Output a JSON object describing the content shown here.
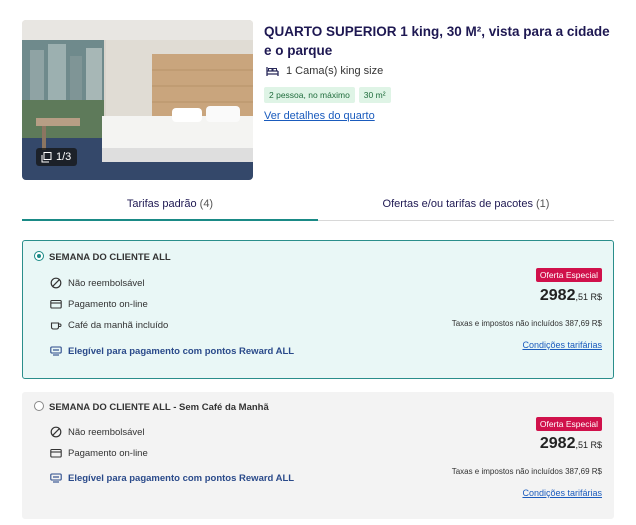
{
  "room": {
    "title": "QUARTO SUPERIOR 1 king, 30 M², vista para a cidade e o parque",
    "bed": "1 Cama(s) king size",
    "tags": [
      "2 pessoa, no máximo",
      "30 m²"
    ],
    "details_link": "Ver detalhes do quarto",
    "photo_counter": "1/3"
  },
  "tabs": [
    {
      "label": "Tarifas padrão",
      "count": "(4)",
      "active": true
    },
    {
      "label": "Ofertas e/ou tarifas de pacotes",
      "count": "(1)",
      "active": false
    }
  ],
  "rates": [
    {
      "name": "SEMANA DO CLIENTE ALL",
      "selected": true,
      "features": [
        "Não reembolsável",
        "Pagamento on-line",
        "Café da manhã incluído"
      ],
      "reward": "Elegível para pagamento com pontos Reward ALL",
      "badge": "Oferta Especial",
      "price_int": "2982",
      "price_dec": ",51 R$",
      "taxes": "Taxas e impostos não incluídos 387,69 R$",
      "conditions": "Condições tarifárias"
    },
    {
      "name": "SEMANA DO CLIENTE ALL - Sem Café da Manhã",
      "selected": false,
      "features": [
        "Não reembolsável",
        "Pagamento on-line"
      ],
      "reward": "Elegível para pagamento com pontos Reward ALL",
      "badge": "Oferta Especial",
      "price_int": "2982",
      "price_dec": ",51 R$",
      "taxes": "Taxas e impostos não incluídos 387,69 R$",
      "conditions": "Condições tarifárias"
    }
  ],
  "colors": {
    "accent_teal": "#1a8a86",
    "badge_red": "#d0114b",
    "link_blue": "#1a5bbd",
    "title_navy": "#1e1852",
    "tag_green_bg": "#dff4e6"
  }
}
